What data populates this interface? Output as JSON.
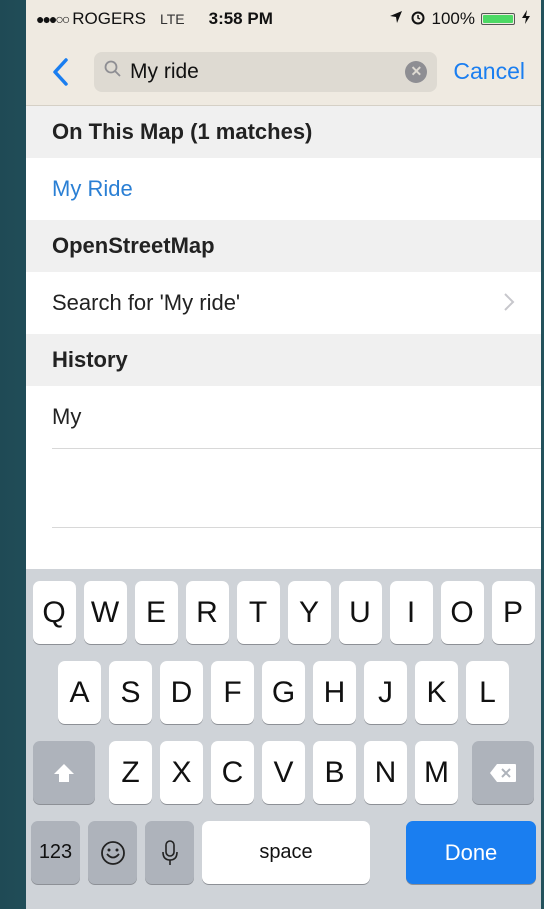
{
  "status_bar": {
    "signal": "●●●○○",
    "carrier": "ROGERS",
    "network": "LTE",
    "time": "3:58 PM",
    "battery": "100%",
    "battery_level": 1.0
  },
  "nav": {
    "search_value": "My ride",
    "cancel_label": "Cancel"
  },
  "sections": [
    {
      "header": "On This Map (1 matches)",
      "items": [
        "My Ride"
      ]
    },
    {
      "header": "OpenStreetMap",
      "items": [
        "Search for 'My ride'"
      ]
    },
    {
      "header": "History",
      "items": [
        "My"
      ]
    }
  ],
  "keyboard": {
    "row1": [
      "Q",
      "W",
      "E",
      "R",
      "T",
      "Y",
      "U",
      "I",
      "O",
      "P"
    ],
    "row2": [
      "A",
      "S",
      "D",
      "F",
      "G",
      "H",
      "J",
      "K",
      "L"
    ],
    "row3": [
      "Z",
      "X",
      "C",
      "V",
      "B",
      "N",
      "M"
    ],
    "numbers_label": "123",
    "space_label": "space",
    "done_label": "Done"
  },
  "colors": {
    "accent": "#1a7ef0",
    "bar_background": "#efeae1",
    "keyboard_background": "#cfd3d8"
  }
}
